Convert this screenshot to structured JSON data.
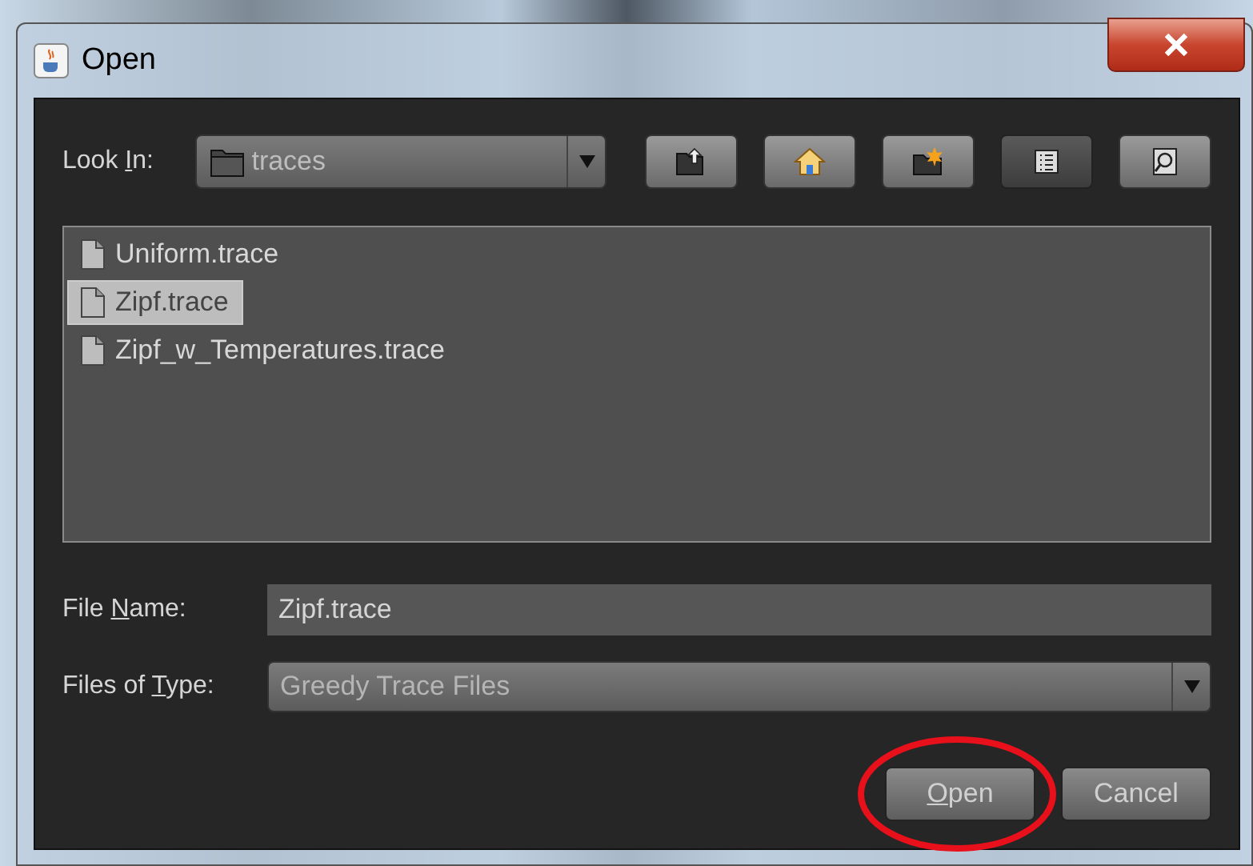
{
  "window": {
    "title": "Open"
  },
  "look_in": {
    "label": {
      "before": "Look ",
      "mnemonic": "I",
      "after": "n:"
    },
    "value": "traces"
  },
  "toolbar": [
    {
      "kind": "up",
      "selected": false
    },
    {
      "kind": "home",
      "selected": false
    },
    {
      "kind": "new-folder",
      "selected": false
    },
    {
      "kind": "list",
      "selected": true
    },
    {
      "kind": "details",
      "selected": false
    }
  ],
  "files": [
    {
      "name": "Uniform.trace",
      "selected": false
    },
    {
      "name": "Zipf.trace",
      "selected": true
    },
    {
      "name": "Zipf_w_Temperatures.trace",
      "selected": false
    }
  ],
  "file_name": {
    "label": {
      "before": "File ",
      "mnemonic": "N",
      "after": "ame:"
    },
    "value": "Zipf.trace"
  },
  "files_of_type": {
    "label": {
      "before": "Files of ",
      "mnemonic": "T",
      "after": "ype:"
    },
    "value": "Greedy Trace Files"
  },
  "buttons": [
    {
      "label": {
        "mnemonic": "O",
        "after": "pen"
      },
      "highlighted": true
    },
    {
      "label": {
        "after": "Cancel"
      },
      "highlighted": false
    }
  ]
}
